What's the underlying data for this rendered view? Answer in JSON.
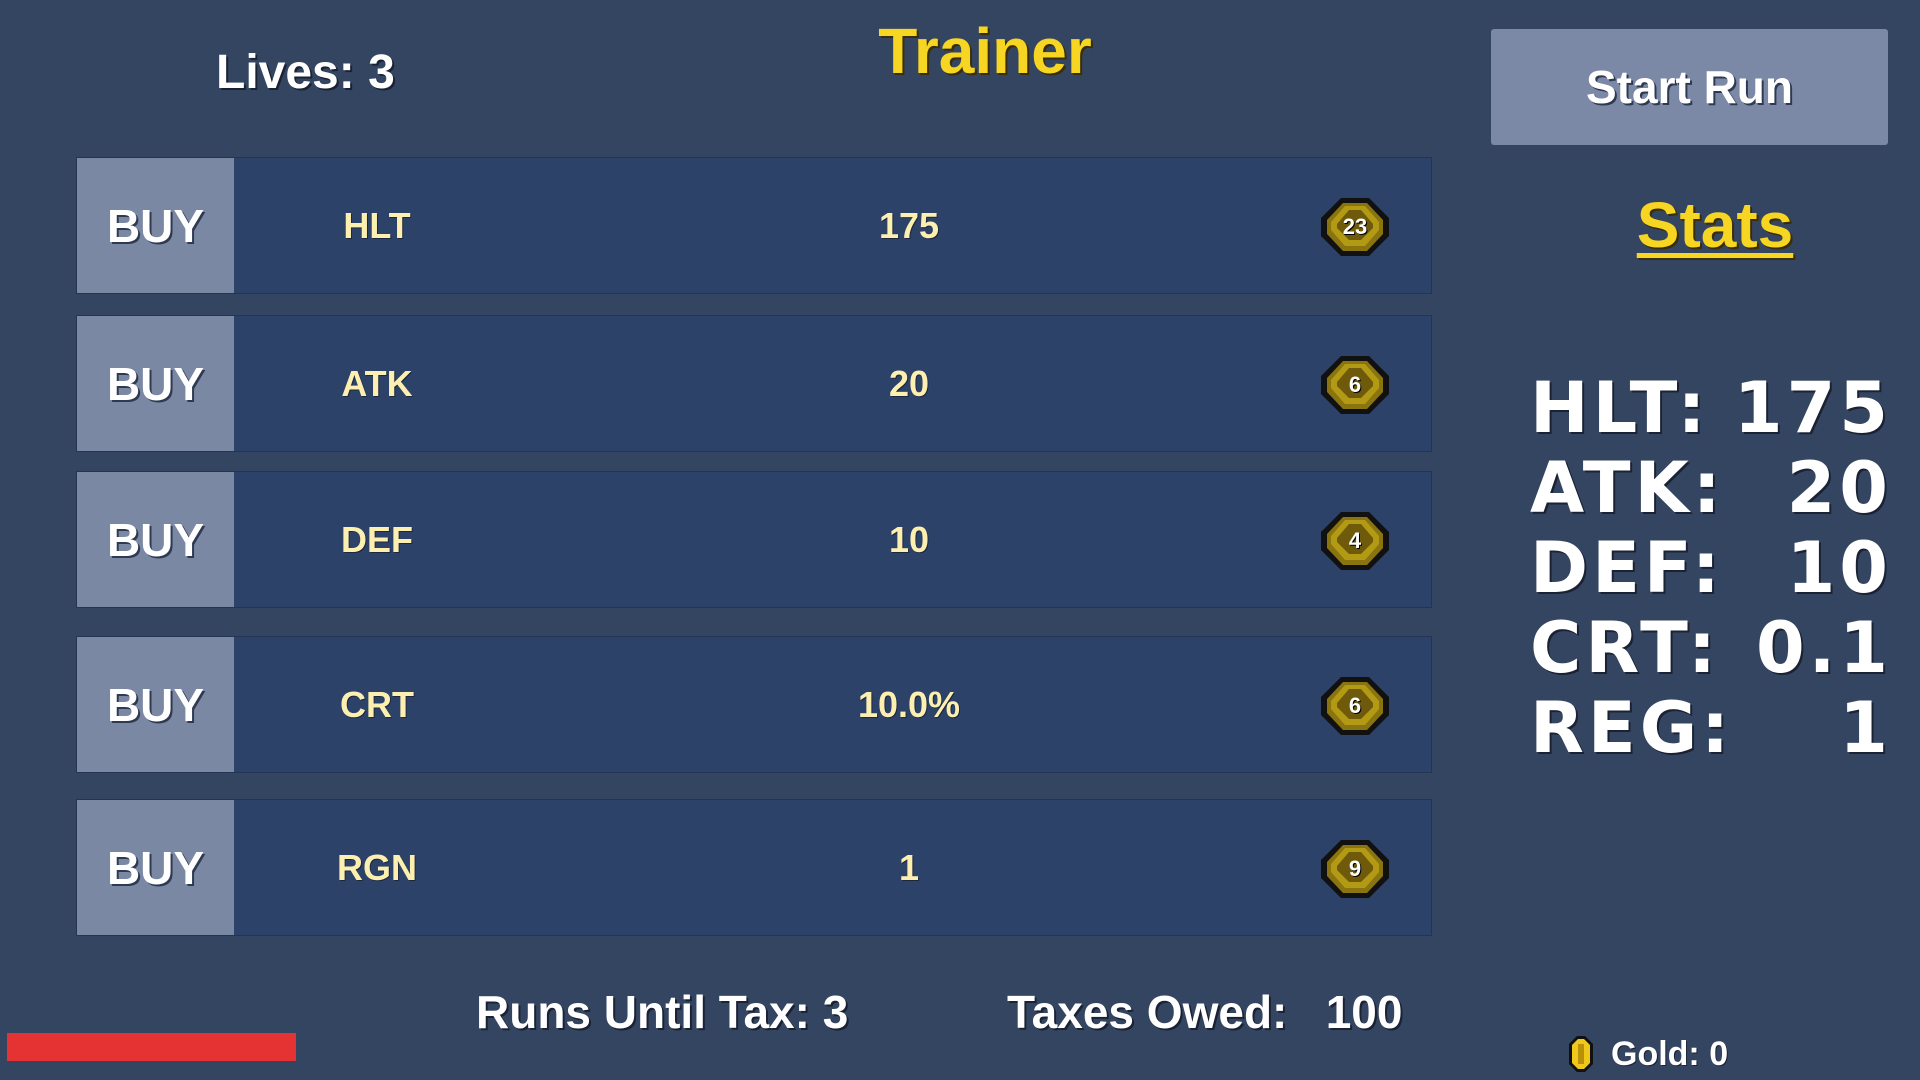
{
  "header": {
    "title": "Trainer",
    "lives_label": "Lives: 3",
    "start_run_label": "Start Run"
  },
  "shop": {
    "buy_label": "BUY",
    "rows": [
      {
        "stat": "HLT",
        "value": "175",
        "cost": "23"
      },
      {
        "stat": "ATK",
        "value": "20",
        "cost": "6"
      },
      {
        "stat": "DEF",
        "value": "10",
        "cost": "4"
      },
      {
        "stat": "CRT",
        "value": "10.0%",
        "cost": "6"
      },
      {
        "stat": "RGN",
        "value": "1",
        "cost": "9"
      }
    ]
  },
  "stats_panel": {
    "heading": "Stats",
    "lines": [
      {
        "label": "HLT:",
        "value": "175"
      },
      {
        "label": "ATK:",
        "value": "20"
      },
      {
        "label": "DEF:",
        "value": "10"
      },
      {
        "label": "CRT:",
        "value": "0.1"
      },
      {
        "label": "REG:",
        "value": "1"
      }
    ]
  },
  "footer": {
    "runs_until_tax": "Runs Until Tax: 3",
    "taxes_owed": "Taxes Owed:   100",
    "gold": "Gold: 0"
  },
  "colors": {
    "background": "#344561",
    "title_yellow": "#f6d523",
    "row_bg": "#2c4268",
    "button_bg": "#7a88a4",
    "health_red": "#e53232",
    "coin_gold": "#d6b21c"
  },
  "icons": {
    "coin": "coin-icon"
  }
}
